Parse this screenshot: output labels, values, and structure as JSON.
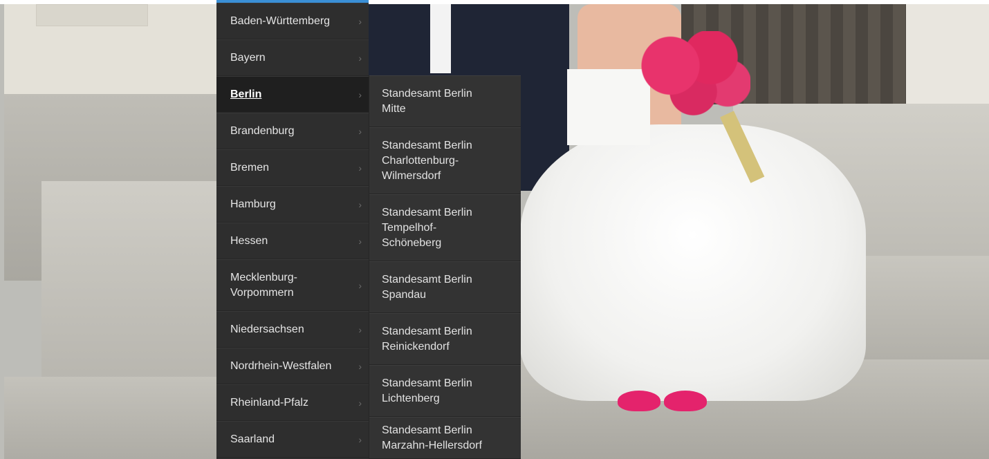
{
  "menu": {
    "items": [
      {
        "label": "Baden-Württemberg",
        "active": false
      },
      {
        "label": "Bayern",
        "active": false
      },
      {
        "label": "Berlin",
        "active": true
      },
      {
        "label": "Brandenburg",
        "active": false
      },
      {
        "label": "Bremen",
        "active": false
      },
      {
        "label": "Hamburg",
        "active": false
      },
      {
        "label": "Hessen",
        "active": false
      },
      {
        "label": "Mecklenburg-Vorpommern",
        "active": false
      },
      {
        "label": "Niedersachsen",
        "active": false
      },
      {
        "label": "Nordrhein-Westfalen",
        "active": false
      },
      {
        "label": "Rheinland-Pfalz",
        "active": false
      },
      {
        "label": "Saarland",
        "active": false
      }
    ],
    "chevron": "›"
  },
  "submenu": {
    "items": [
      {
        "label": "Standesamt Berlin Mitte"
      },
      {
        "label": "Standesamt Berlin Charlottenburg-Wilmersdorf"
      },
      {
        "label": "Standesamt Berlin Tempelhof-Schöneberg"
      },
      {
        "label": "Standesamt Berlin Spandau"
      },
      {
        "label": "Standesamt Berlin Reinickendorf"
      },
      {
        "label": "Standesamt Berlin Lichtenberg"
      },
      {
        "label": "Standesamt Berlin Marzahn-Hellersdorf"
      }
    ]
  },
  "colors": {
    "menu_bg": "#2e2e2e",
    "accent": "#3a8fd6",
    "text": "#e5e5e5"
  }
}
